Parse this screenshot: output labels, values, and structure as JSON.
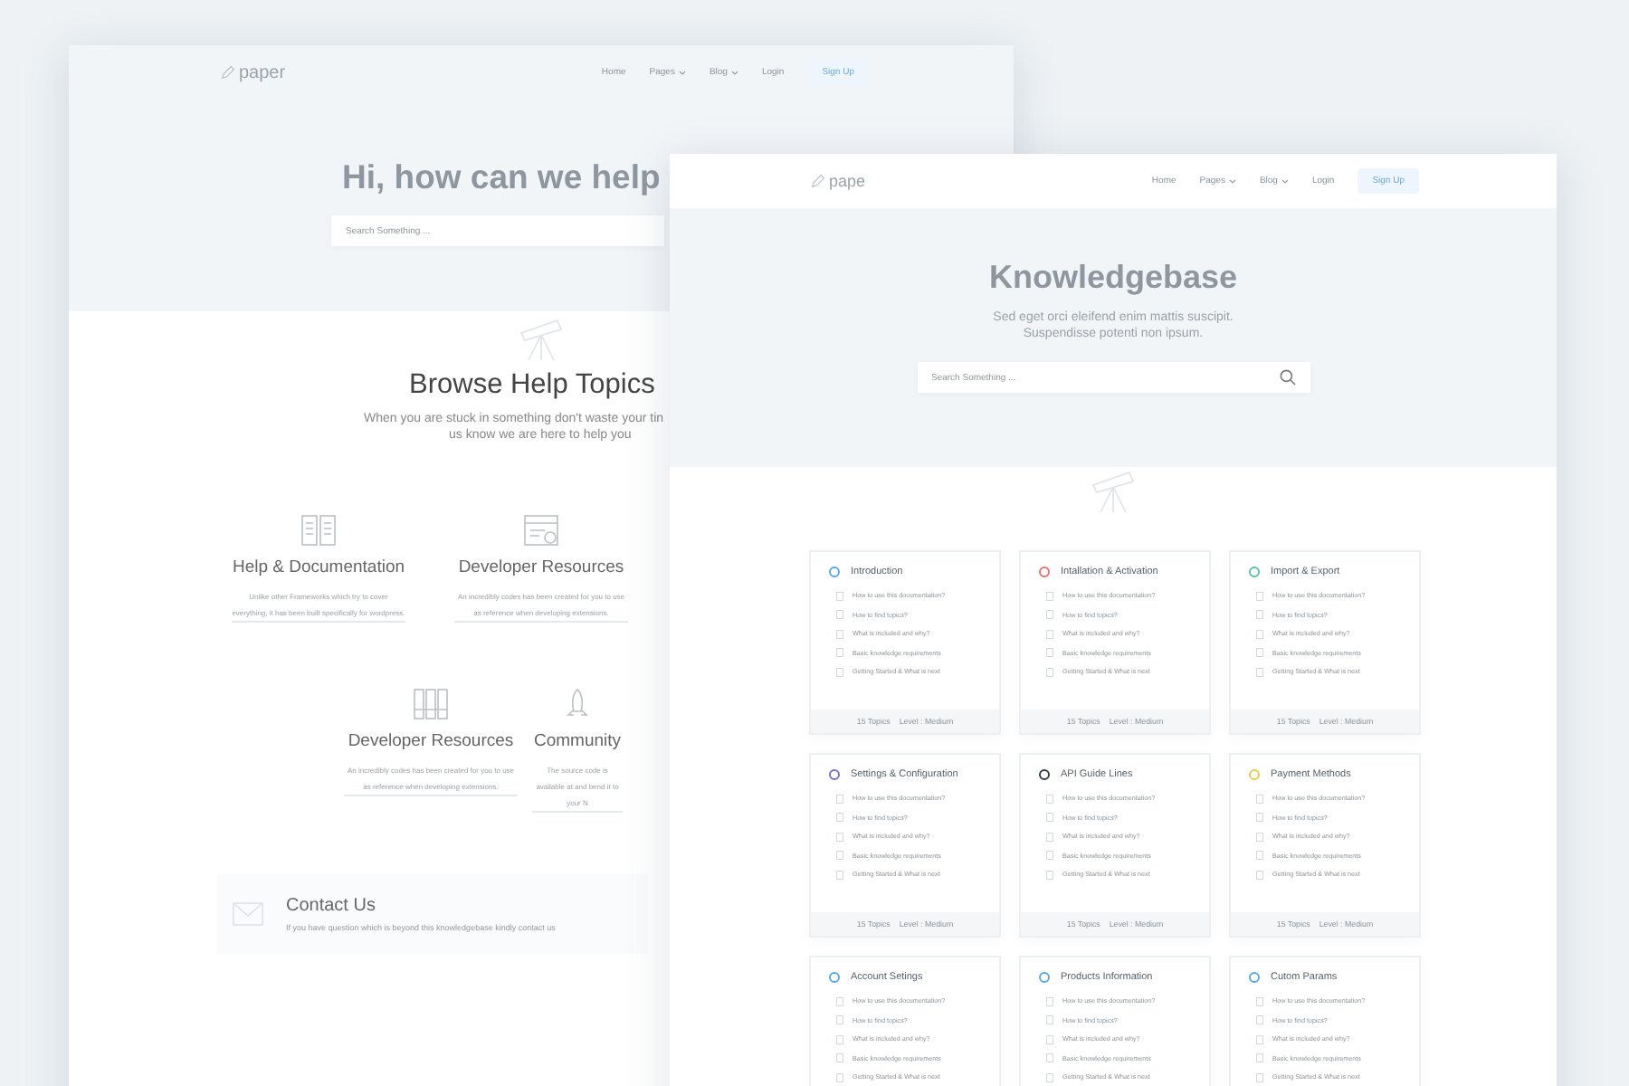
{
  "back_page": {
    "logo": "paper",
    "nav": [
      {
        "label": "Home",
        "kind": "link"
      },
      {
        "label": "Pages",
        "kind": "dropdown"
      },
      {
        "label": "Blog",
        "kind": "dropdown"
      },
      {
        "label": "Login",
        "kind": "link"
      },
      {
        "label": "Sign Up",
        "kind": "button"
      }
    ],
    "hero_title": "Hi, how can we help",
    "search": {
      "placeholder": "Search Something ..."
    },
    "section_title": "Browse Help Topics",
    "section_subtitle": [
      "When you are stuck in something don't waste your tin",
      "us know we are here to help you"
    ],
    "topic_rows": [
      [
        {
          "title": "Help & Documentation",
          "description": "Unlike other Frameworks which try to cover everything, it has been built specifically for wordpress."
        },
        {
          "title": "Developer Resources",
          "description": "An incredibly codes has been created for you to use as reference when developing extensions."
        }
      ],
      [
        {
          "title": "Developer Resources",
          "description": "An incredibly codes has been created for you to use as reference when developing extensions."
        },
        {
          "title": "Community",
          "description": "The source code is available at and bend it to your N"
        }
      ]
    ],
    "contact": {
      "title": "Contact Us",
      "text": "If you have question which is beyond this knowledgebase kindly contact us"
    }
  },
  "front_page": {
    "logo": "pape",
    "nav": [
      {
        "label": "Home",
        "kind": "link"
      },
      {
        "label": "Pages",
        "kind": "dropdown"
      },
      {
        "label": "Blog",
        "kind": "dropdown"
      },
      {
        "label": "Login",
        "kind": "link"
      },
      {
        "label": "Sign Up",
        "kind": "button"
      }
    ],
    "hero_title": "Knowledgebase",
    "hero_subtitle": [
      "Sed eget orci eleifend enim mattis suscipit.",
      "Suspendisse potenti non ipsum."
    ],
    "search": {
      "placeholder": "Search Something ..."
    },
    "categories": [
      {
        "title": "Introduction",
        "color": "#5aa9e6",
        "articles": [
          "How to use this documentation?",
          "How to find topics?",
          "What is included and why?",
          "Basic knowledge requirements",
          "Getting Started & What is next"
        ],
        "topics": "15 Topics",
        "level": "Level : Medium"
      },
      {
        "title": "Intallation & Activation",
        "color": "#e57373",
        "articles": [
          "How to use this documentation?",
          "How to find topics?",
          "What is included and why?",
          "Basic knowledge requirements",
          "Getting Started & What is next"
        ],
        "topics": "15 Topics",
        "level": "Level : Medium"
      },
      {
        "title": "Import & Export",
        "color": "#5cc0a8",
        "articles": [
          "How to use this documentation?",
          "How to find topics?",
          "What is included and why?",
          "Basic knowledge requirements",
          "Getting Started & What is next"
        ],
        "topics": "15 Topics",
        "level": "Level : Medium"
      },
      {
        "title": "Settings & Configuration",
        "color": "#7a6fc0",
        "articles": [
          "How to use this documentation?",
          "How to find topics?",
          "What is included and why?",
          "Basic knowledge requirements",
          "Getting Started & What is next"
        ],
        "topics": "15 Topics",
        "level": "Level : Medium"
      },
      {
        "title": "API Guide Lines",
        "color": "#333d47",
        "articles": [
          "How to use this documentation?",
          "How to find topics?",
          "What is included and why?",
          "Basic knowledge requirements",
          "Getting Started & What is next"
        ],
        "topics": "15 Topics",
        "level": "Level : Medium"
      },
      {
        "title": "Payment Methods",
        "color": "#f0c94a",
        "articles": [
          "How to use this documentation?",
          "How to find topics?",
          "What is included and why?",
          "Basic knowledge requirements",
          "Getting Started & What is next"
        ],
        "topics": "15 Topics",
        "level": "Level : Medium"
      },
      {
        "title": "Account Setings",
        "color": "#5aa9e6",
        "articles": [
          "How to use this documentation?",
          "How to find topics?",
          "What is included and why?",
          "Basic knowledge requirements",
          "Getting Started & What is next"
        ]
      },
      {
        "title": "Products Information",
        "color": "#5aa9e6",
        "articles": [
          "How to use this documentation?",
          "How to find topics?",
          "What is included and why?",
          "Basic knowledge requirements",
          "Getting Started & What is next"
        ]
      },
      {
        "title": "Cutom Params",
        "color": "#5aa9e6",
        "articles": [
          "How to use this documentation?",
          "How to find topics?",
          "What is included and why?",
          "Basic knowledge requirements",
          "Getting Started & What is next"
        ]
      }
    ]
  }
}
